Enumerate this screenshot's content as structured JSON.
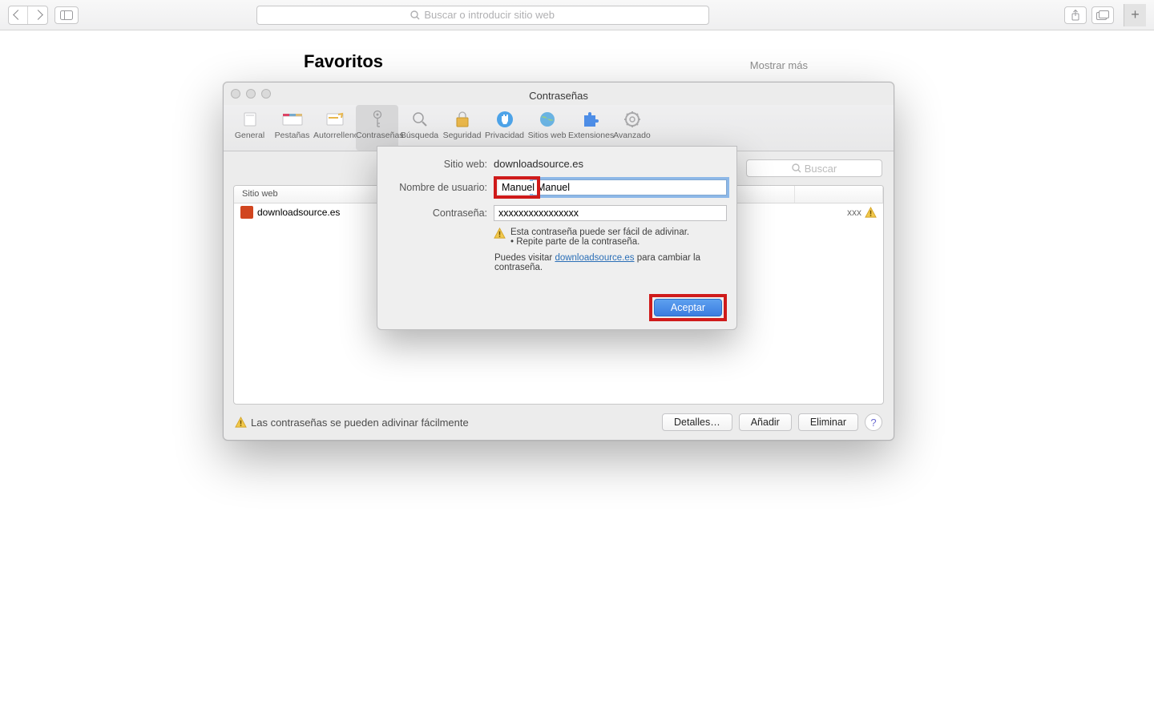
{
  "browser": {
    "address_placeholder": "Buscar o introducir sitio web"
  },
  "favorites": {
    "title": "Favoritos",
    "show_more": "Mostrar más"
  },
  "prefs": {
    "title": "Contraseñas",
    "tabs": {
      "general": "General",
      "tabs": "Pestañas",
      "autofill": "Autorrelleno",
      "passwords": "Contraseñas",
      "search": "Búsqueda",
      "security": "Seguridad",
      "privacy": "Privacidad",
      "websites": "Sitios web",
      "extensions": "Extensiones",
      "advanced": "Avanzado"
    },
    "search_placeholder": "Buscar",
    "columns": {
      "site": "Sitio web"
    },
    "row": {
      "site": "downloadsource.es",
      "pass_tail": "xxx"
    },
    "warn_footer": "Las contraseñas se pueden adivinar fácilmente",
    "buttons": {
      "details": "Detalles…",
      "add": "Añadir",
      "delete": "Eliminar"
    }
  },
  "sheet": {
    "labels": {
      "site": "Sitio web:",
      "user": "Nombre de usuario:",
      "pass": "Contraseña:"
    },
    "site_value": "downloadsource.es",
    "user_value": "Manuel",
    "pass_value": "xxxxxxxxxxxxxxxx",
    "warn1": "Esta contraseña puede ser fácil de adivinar.",
    "warn2": "• Repite parte de la contraseña.",
    "visit_pre": "Puedes visitar ",
    "visit_link": "downloadsource.es",
    "visit_post": " para cambiar la contraseña.",
    "accept": "Aceptar"
  }
}
